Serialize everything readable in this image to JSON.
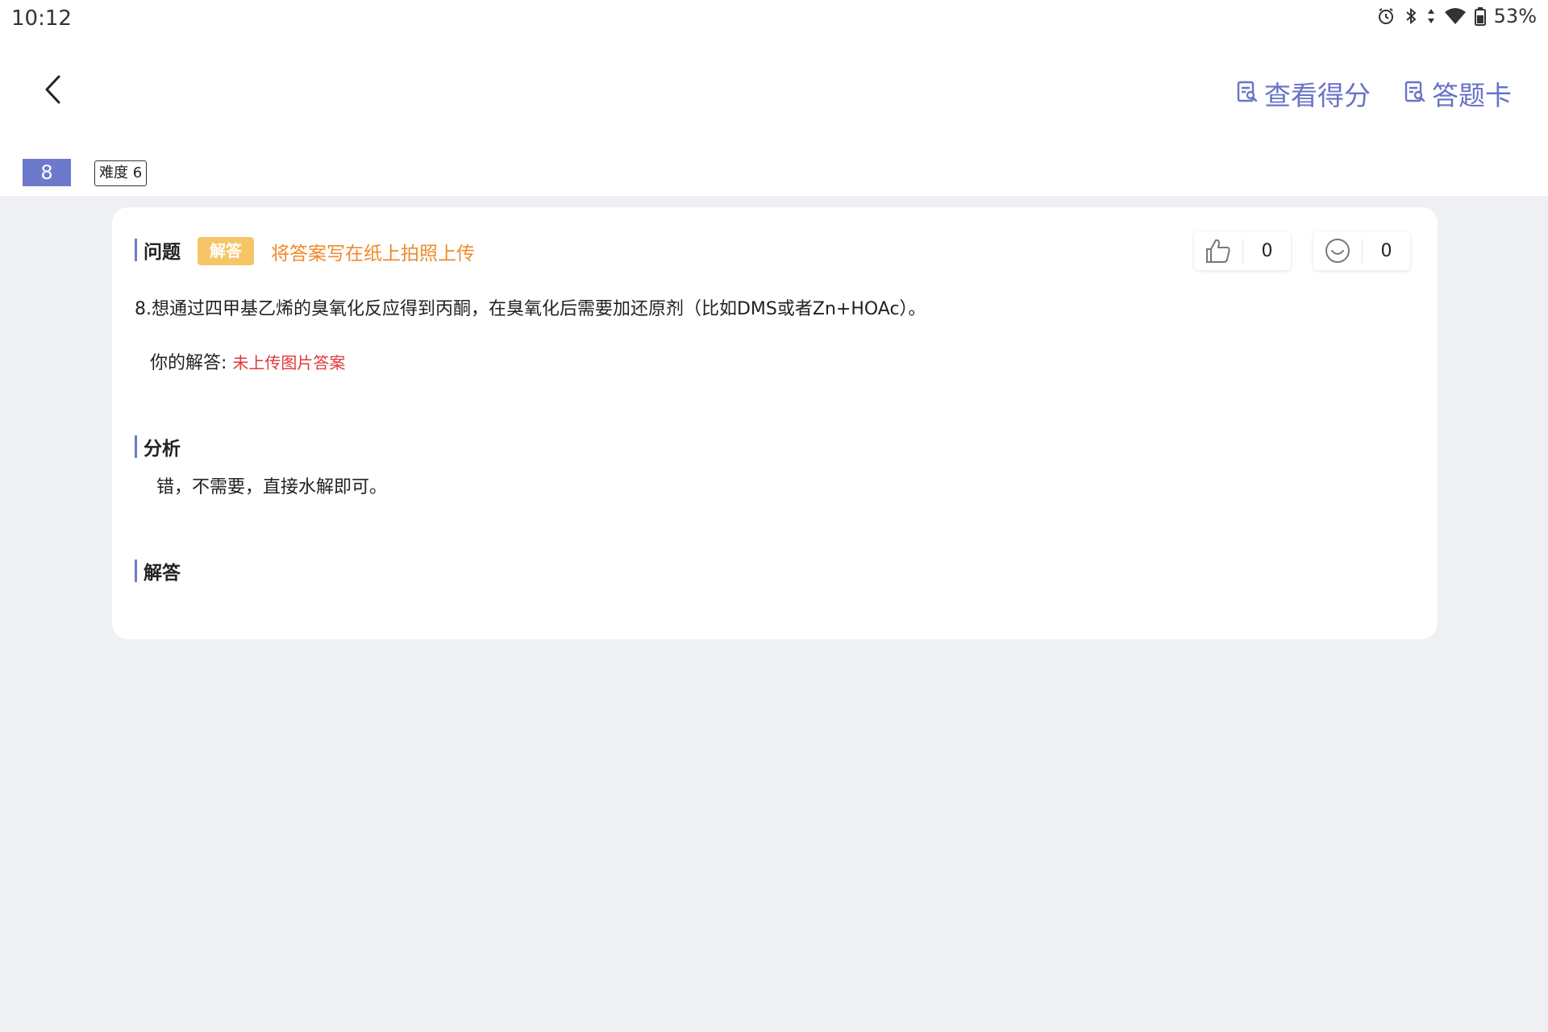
{
  "status_bar": {
    "time": "10:12",
    "battery": "53%",
    "icons": [
      "alarm-icon",
      "bluetooth-icon",
      "data-arrows-icon",
      "wifi-icon",
      "battery-icon"
    ]
  },
  "header": {
    "score_label": "查看得分",
    "card_label": "答题卡"
  },
  "question": {
    "number": "8",
    "difficulty": "难度 6",
    "section_title": "问题",
    "type_tag": "解答",
    "instruction": "将答案写在纸上拍照上传",
    "text": "8.想通过四甲基乙烯的臭氧化反应得到丙酮，在臭氧化后需要加还原剂（比如DMS或者Zn+HOAc）。",
    "likes": "0",
    "reactions": "0",
    "your_answer_label": "你的解答: ",
    "your_answer_value": "未上传图片答案"
  },
  "analysis": {
    "title": "分析",
    "text": "错，不需要，直接水解即可。"
  },
  "solution": {
    "title": "解答"
  },
  "colors": {
    "accent": "#6d7acb",
    "header_action": "#6873c6",
    "tag_bg": "#f6c565",
    "instruction": "#f08a2a",
    "error": "#e0383a",
    "page_bg": "#eef0f4"
  }
}
